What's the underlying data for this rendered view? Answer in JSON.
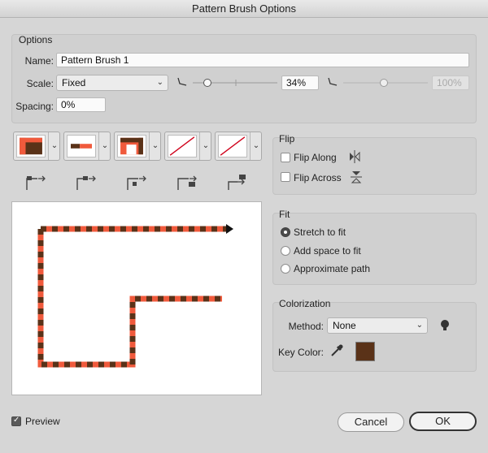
{
  "window": {
    "title": "Pattern Brush Options"
  },
  "options": {
    "heading": "Options",
    "name_label": "Name:",
    "name_value": "Pattern Brush 1",
    "scale_label": "Scale:",
    "scale_value": "Fixed",
    "scale_percent": "34%",
    "scale_percent2": "100%",
    "spacing_label": "Spacing:",
    "spacing_value": "0%"
  },
  "tiles": [
    {
      "name": "side-tile"
    },
    {
      "name": "outer-corner-tile"
    },
    {
      "name": "inner-corner-tile"
    },
    {
      "name": "start-tile"
    },
    {
      "name": "end-tile"
    }
  ],
  "flip": {
    "heading": "Flip",
    "along_label": "Flip Along",
    "across_label": "Flip Across",
    "along_checked": false,
    "across_checked": false
  },
  "fit": {
    "heading": "Fit",
    "options": [
      "Stretch to fit",
      "Add space to fit",
      "Approximate path"
    ],
    "selected": 0
  },
  "colorization": {
    "heading": "Colorization",
    "method_label": "Method:",
    "method_value": "None",
    "key_color_label": "Key Color:",
    "key_color": "#5a3218"
  },
  "colors": {
    "pattern_orange": "#f05a3c",
    "pattern_brown": "#5a3218"
  },
  "footer": {
    "preview_label": "Preview",
    "preview_checked": true,
    "cancel_label": "Cancel",
    "ok_label": "OK"
  }
}
